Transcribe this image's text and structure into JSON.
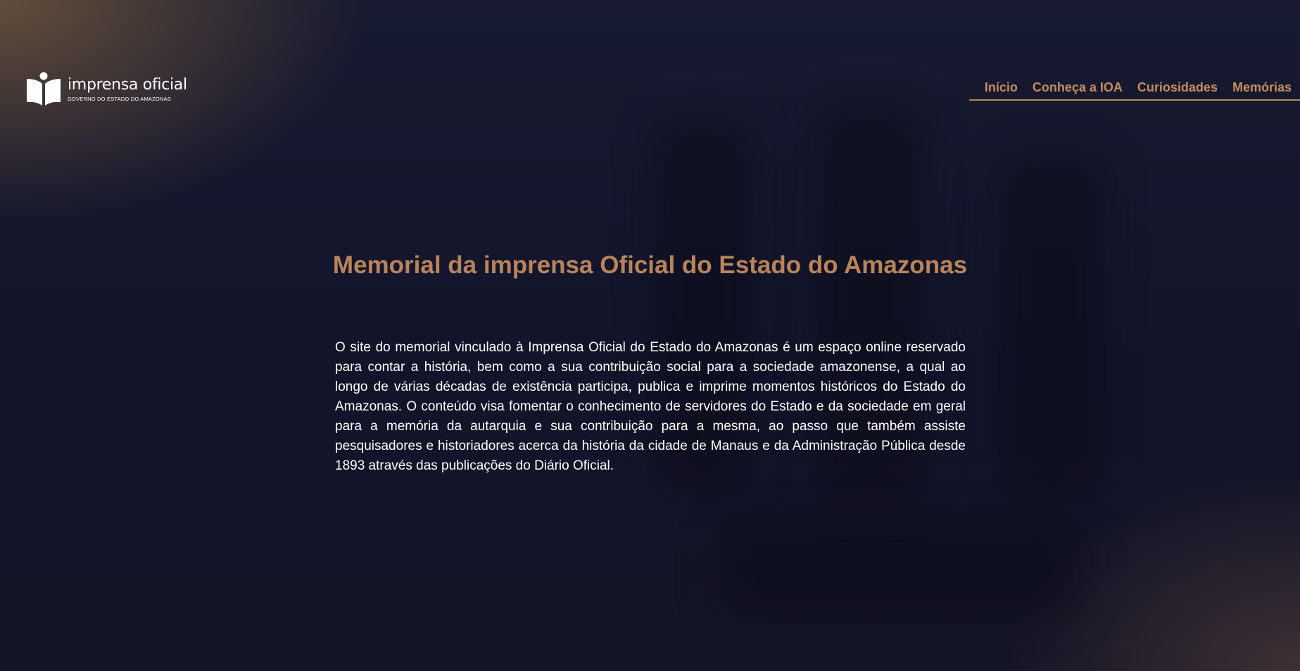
{
  "logo": {
    "name": "imprensa oficial",
    "subtitle": "GOVERNO DO ESTADO DO AMAZONAS"
  },
  "nav": {
    "items": [
      {
        "label": "Início"
      },
      {
        "label": "Conheça a IOA"
      },
      {
        "label": "Curiosidades"
      },
      {
        "label": "Memórias"
      }
    ]
  },
  "hero": {
    "title": "Memorial da imprensa Oficial do Estado do Amazonas",
    "description": "O site do memorial vinculado à Imprensa Oficial do Estado do Amazonas é um espaço online reservado para contar a história, bem como a sua contribuição social para a sociedade amazonense, a qual ao longo de várias décadas de existência participa, publica e imprime momentos históricos do Estado do Amazonas. O conteúdo visa fomentar o conhecimento de servidores do Estado e da sociedade em geral para a memória da autarquia e sua contribuição para a mesma, ao passo que também assiste pesquisadores e historiadores acerca da história da cidade de Manaus e da Administração Pública desde 1893 através das publicações do Diário Oficial."
  },
  "colors": {
    "accent": "#c48d5c",
    "title": "#b8845a",
    "background": "#141628",
    "text": "#ffffff"
  },
  "icons": {
    "logo": "open-book-person-icon"
  }
}
